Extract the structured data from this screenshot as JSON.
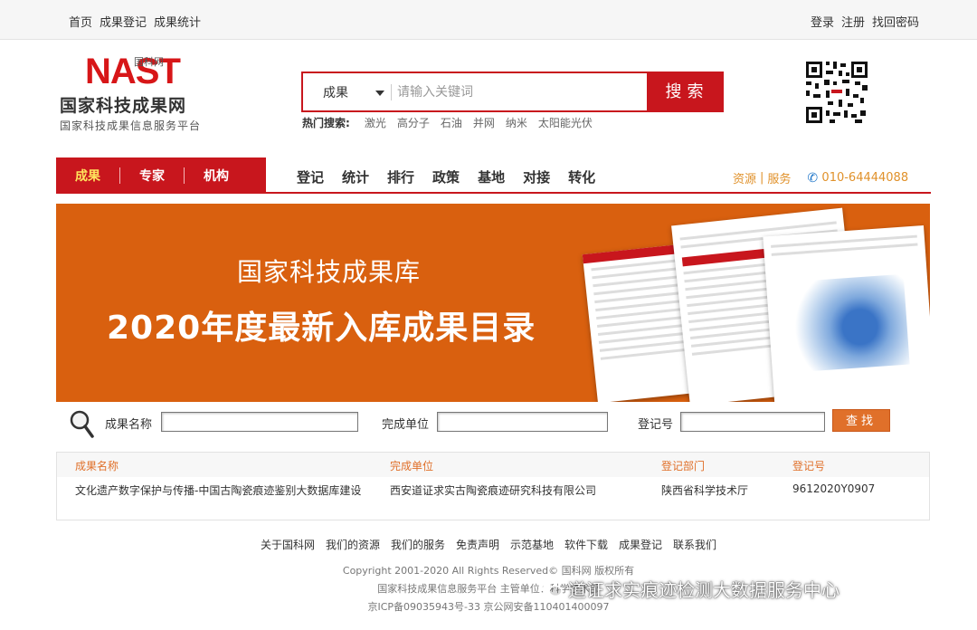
{
  "topbar": {
    "left_links": [
      "首页",
      "成果登记",
      "成果统计"
    ],
    "right_links": [
      "登录",
      "注册",
      "找回密码"
    ]
  },
  "logo": {
    "nast": "NAST",
    "small": "国科网",
    "title": "国家科技成果网",
    "subtitle": "国家科技成果信息服务平台"
  },
  "search": {
    "category": "成果",
    "placeholder": "请输入关键词",
    "button": "搜索",
    "hot_label": "热门搜索:",
    "hot_terms": [
      "激光",
      "高分子",
      "石油",
      "并网",
      "纳米",
      "太阳能光伏"
    ]
  },
  "nav": {
    "tabs": [
      "成果",
      "专家",
      "机构"
    ],
    "active_tab": "成果",
    "links": [
      "登记",
      "统计",
      "排行",
      "政策",
      "基地",
      "对接",
      "转化"
    ],
    "resources": "资源",
    "services": "服务",
    "phone": "010-64444088"
  },
  "banner": {
    "title1": "国家科技成果库",
    "title2": "2020年度最新入库成果目录"
  },
  "query": {
    "name_label": "成果名称",
    "unit_label": "完成单位",
    "reg_label": "登记号",
    "button": "查找"
  },
  "results": {
    "headers": [
      "成果名称",
      "完成单位",
      "登记部门",
      "登记号"
    ],
    "rows": [
      [
        "文化遗产数字保护与传播-中国古陶瓷痕迹鉴别大数据库建设",
        "西安道证求实古陶瓷痕迹研究科技有限公司",
        "陕西省科学技术厅",
        "9612020Y0907"
      ]
    ]
  },
  "footer": {
    "links": [
      "关于国科网",
      "我们的资源",
      "我们的服务",
      "免责声明",
      "示范基地",
      "软件下载",
      "成果登记",
      "联系我们"
    ],
    "copyright": "Copyright 2001-2020 All Rights Reserved© 国科网 版权所有",
    "platform": "国家科技成果信息服务平台 主管单位：科学技术部",
    "icp": "京ICP备09035943号-33 京公网安备110401400097"
  },
  "watermark": "道证求实痕迹检测大数据服务中心",
  "colors": {
    "brand_red": "#c8161d",
    "banner_orange": "#d9600f",
    "accent_orange": "#e0702a",
    "link_orange": "#e0912a"
  }
}
